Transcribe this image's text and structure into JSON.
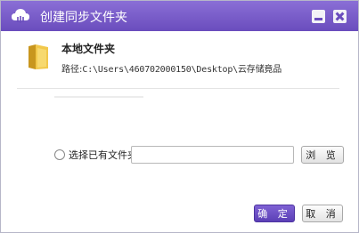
{
  "window": {
    "title": "创建同步文件夹"
  },
  "folder": {
    "name": "本地文件夹",
    "path_label": "路径:",
    "path_value": "C:\\Users\\460702000150\\Desktop\\云存储竟品"
  },
  "option": {
    "choose_existing_label": "选择已有文件夹",
    "input_value": ""
  },
  "buttons": {
    "browse": "浏 览",
    "ok": "确 定",
    "cancel": "取 消"
  },
  "icons": {
    "app": "cloud-app-icon",
    "folder": "folder-icon"
  },
  "colors": {
    "titlebar": "#6a4dbd",
    "accent": "#5b3fb6"
  }
}
